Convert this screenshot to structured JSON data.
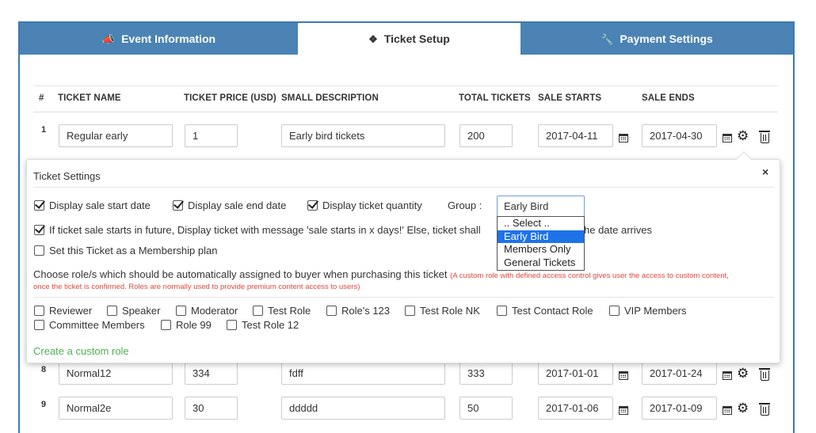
{
  "tabs": [
    {
      "label": "Event Information",
      "icon": "bullhorn-icon"
    },
    {
      "label": "Ticket Setup",
      "icon": "ticket-icon"
    },
    {
      "label": "Payment Settings",
      "icon": "wrench-icon"
    }
  ],
  "table": {
    "headers": [
      "#",
      "TICKET NAME",
      "TICKET PRICE (USD)",
      "SMALL DESCRIPTION",
      "TOTAL TICKETS",
      "SALE STARTS",
      "SALE ENDS"
    ],
    "rows": [
      {
        "num": "1",
        "name": "Regular early",
        "price": "1",
        "description": "Early bird tickets",
        "total": "200",
        "start": "2017-04-11",
        "end": "2017-04-30"
      },
      {
        "num": "8",
        "name": "Normal12",
        "price": "334",
        "description": "fdff",
        "total": "333",
        "start": "2017-01-01",
        "end": "2017-01-24"
      },
      {
        "num": "9",
        "name": "Normal2e",
        "price": "30",
        "description": "ddddd",
        "total": "50",
        "start": "2017-01-06",
        "end": "2017-01-09"
      }
    ]
  },
  "settings": {
    "title": "Ticket Settings",
    "close": "×",
    "display_start": "Display sale start date",
    "display_end": "Display sale end date",
    "display_qty": "Display ticket quantity",
    "group_label": "Group :",
    "group_value": "Early Bird",
    "group_options": [
      ".. Select ..",
      "Early Bird",
      "Members Only",
      "General Tickets"
    ],
    "future_msg_a": "If ticket sale starts in future, Display ticket with message 'sale starts in x days!' Else, ticket shall",
    "future_msg_b": "he date arrives",
    "membership": "Set this Ticket as a Membership plan",
    "roles_intro": "Choose role/s which should be automatically assigned to buyer when purchasing this ticket",
    "roles_note_1": "(A custom role with defined access control gives user the access to custom content,",
    "roles_note_2": "once the ticket is confirmed. Roles are normally used to provide premium content access to users)",
    "roles_row1": [
      "Reviewer",
      "Speaker",
      "Moderator",
      "Test Role",
      "Role's 123",
      "Test Role NK",
      "Test Contact Role",
      "VIP Members"
    ],
    "roles_row2": [
      "Committee Members",
      "Role 99",
      "Test Role 12"
    ],
    "create_role": "Create a custom role"
  },
  "colors": {
    "tab_bar": "#4a83b4",
    "selected_option": "#1e73e8",
    "create_link": "#4cb050",
    "note_red": "#e0463f"
  }
}
